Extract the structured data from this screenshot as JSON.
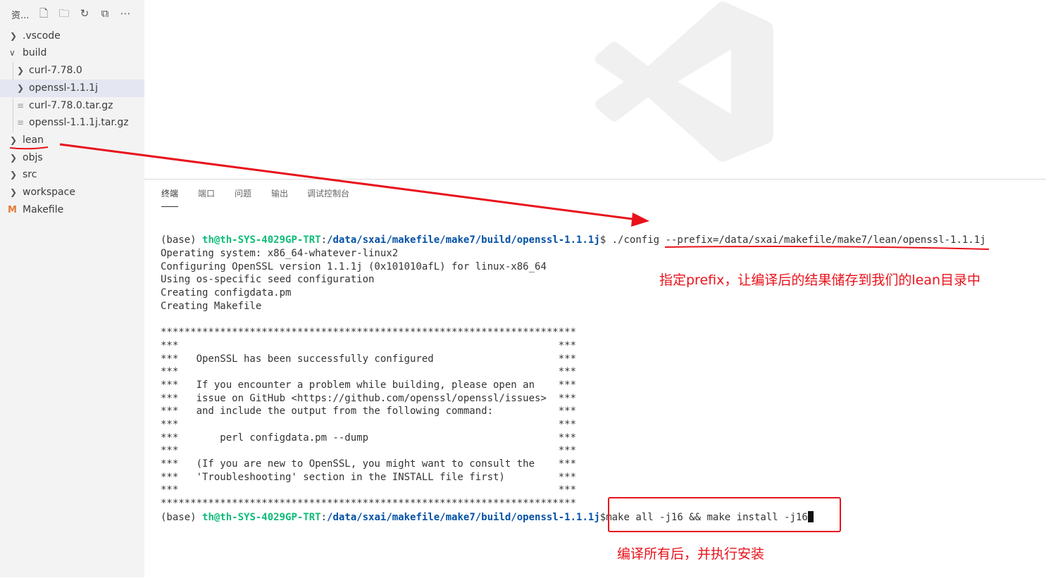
{
  "explorer": {
    "title": "资...",
    "toolbar": [
      {
        "icon": "new-file-icon",
        "glyph": "🗋"
      },
      {
        "icon": "new-folder-icon",
        "glyph": "🗀"
      },
      {
        "icon": "refresh-icon",
        "glyph": "↻"
      },
      {
        "icon": "collapse-all-icon",
        "glyph": "⧉"
      },
      {
        "icon": "more-icon",
        "glyph": "⋯"
      }
    ],
    "items": [
      {
        "label": ".vscode",
        "type": "folder",
        "expanded": false
      },
      {
        "label": "build",
        "type": "folder",
        "expanded": true
      },
      {
        "label": "curl-7.78.0",
        "type": "folder",
        "expanded": false
      },
      {
        "label": "openssl-1.1.1j",
        "type": "folder",
        "expanded": false,
        "selected": true
      },
      {
        "label": "curl-7.78.0.tar.gz",
        "type": "file"
      },
      {
        "label": "openssl-1.1.1j.tar.gz",
        "type": "file"
      },
      {
        "label": "lean",
        "type": "folder",
        "expanded": false
      },
      {
        "label": "objs",
        "type": "folder",
        "expanded": false
      },
      {
        "label": "src",
        "type": "folder",
        "expanded": false
      },
      {
        "label": "workspace",
        "type": "folder",
        "expanded": false
      },
      {
        "label": "Makefile",
        "type": "makefile",
        "badge": "M"
      }
    ]
  },
  "panel": {
    "tabs": [
      "终端",
      "端口",
      "问题",
      "输出",
      "调试控制台"
    ],
    "active_tab": "终端"
  },
  "terminal": {
    "prompt_prefix": "(base) ",
    "prompt_user": "th@th-SYS-4029GP-TRT",
    "prompt_colon": ":",
    "prompt_path": "/data/sxai/makefile/make7/build/openssl-1.1.1j",
    "prompt_dollar": "$ ",
    "command1": "./config --prefix=/data/sxai/makefile/make7/lean/openssl-1.1.1j",
    "output": [
      "Operating system: x86_64-whatever-linux2",
      "Configuring OpenSSL version 1.1.1j (0x101010afL) for linux-x86_64",
      "Using os-specific seed configuration",
      "Creating configdata.pm",
      "Creating Makefile",
      "",
      "**********************************************************************",
      "***                                                                ***",
      "***   OpenSSL has been successfully configured                     ***",
      "***                                                                ***",
      "***   If you encounter a problem while building, please open an    ***",
      "***   issue on GitHub <https://github.com/openssl/openssl/issues>  ***",
      "***   and include the output from the following command:           ***",
      "***                                                                ***",
      "***       perl configdata.pm --dump                                ***",
      "***                                                                ***",
      "***   (If you are new to OpenSSL, you might want to consult the    ***",
      "***   'Troubleshooting' section in the INSTALL file first)         ***",
      "***                                                                ***",
      "**********************************************************************"
    ],
    "command2": "make all -j16 && make install -j16"
  },
  "annotations": {
    "prefix_note": "指定prefix，让编译后的结果储存到我们的lean目录中",
    "make_note": "编译所有后，并执行安装",
    "color": "#e8121b"
  }
}
